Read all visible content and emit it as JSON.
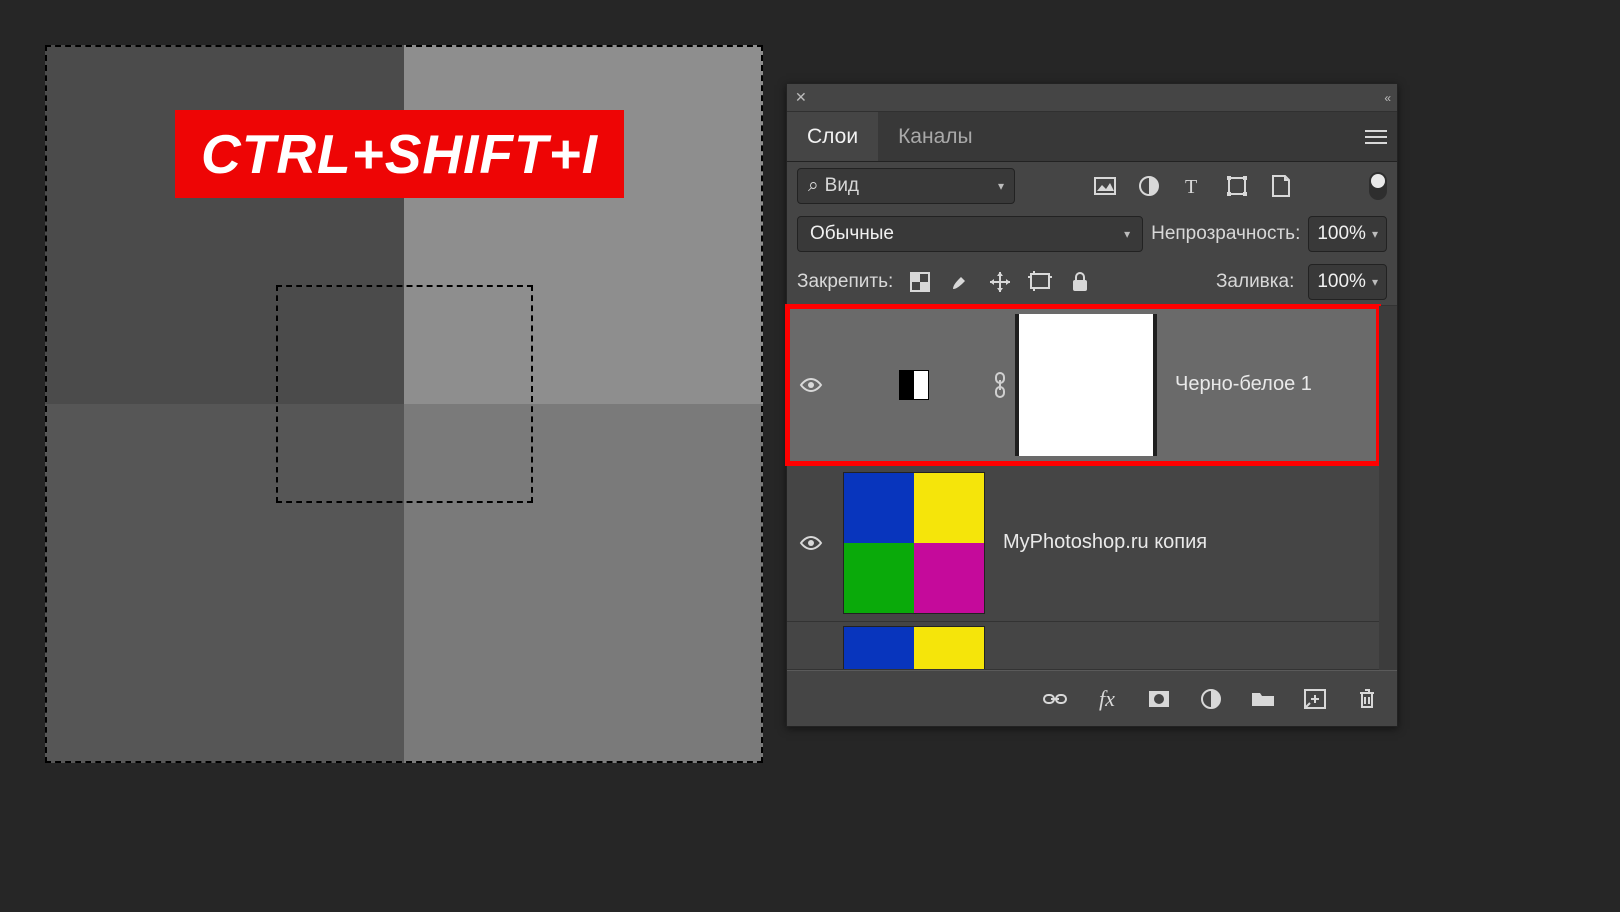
{
  "callout_text": "CTRL+SHIFT+I",
  "panel": {
    "tabs": {
      "layers": "Слои",
      "channels": "Каналы"
    },
    "filter_label": "Вид",
    "blend_mode": "Обычные",
    "opacity_label": "Непрозрачность:",
    "opacity_value": "100%",
    "lock_label": "Закрепить:",
    "fill_label": "Заливка:",
    "fill_value": "100%"
  },
  "layers": [
    {
      "name": "Черно-белое 1",
      "type": "adjustment-bw",
      "visible": true,
      "selected": true,
      "highlighted": true
    },
    {
      "name": "MyPhotoshop.ru копия",
      "type": "color-quad",
      "visible": true,
      "selected": false,
      "highlighted": false
    },
    {
      "name": "",
      "type": "color-half",
      "visible": false,
      "selected": false,
      "highlighted": false
    }
  ],
  "icons": {
    "search": "⌕",
    "hamburger": "≡"
  }
}
